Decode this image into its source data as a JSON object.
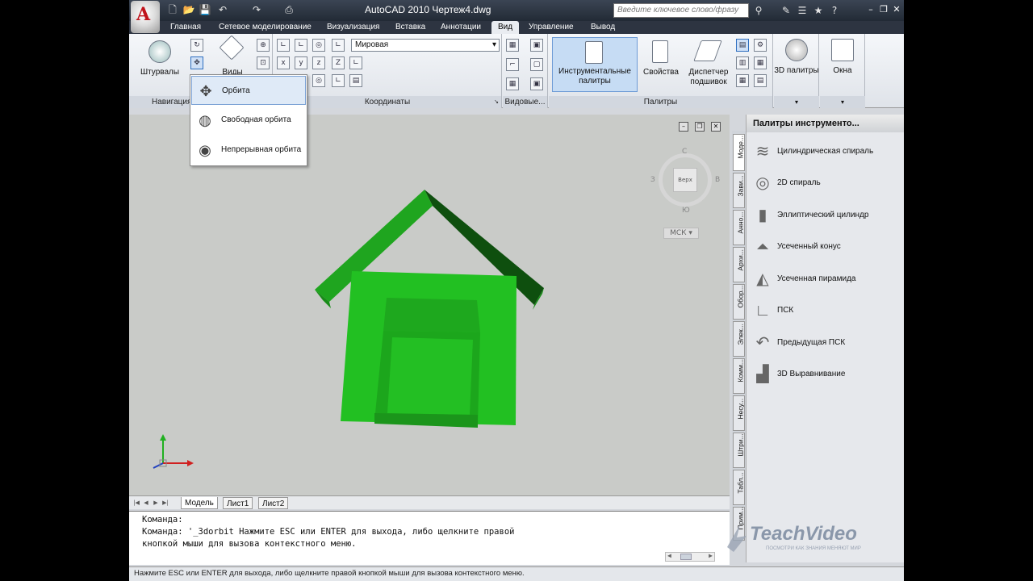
{
  "window": {
    "title": "AutoCAD 2010     Чертеж4.dwg"
  },
  "search": {
    "placeholder": "Введите ключевое слово/фразу"
  },
  "tabs": [
    {
      "label": "Главная"
    },
    {
      "label": "Сетевое моделирование"
    },
    {
      "label": "Визуализация"
    },
    {
      "label": "Вставка"
    },
    {
      "label": "Аннотации"
    },
    {
      "label": "Вид",
      "active": true
    },
    {
      "label": "Управление"
    },
    {
      "label": "Вывод"
    }
  ],
  "ribbon": {
    "navigation": {
      "title": "Навигация",
      "steering_label": "Штурвалы",
      "views_label": "Виды"
    },
    "coordinates": {
      "title": "Координаты",
      "ucs_select": "Мировая"
    },
    "viewports": {
      "title": "Видовые..."
    },
    "palettes": {
      "title": "Палитры",
      "tool_palettes": "Инструментальные палитры",
      "properties": "Свойства",
      "sheet_manager": "Диспетчер подшивок",
      "palettes3d": "3D палитры"
    },
    "windows": {
      "label": "Окна"
    }
  },
  "orbit_menu": {
    "items": [
      {
        "label": "Орбита",
        "selected": true
      },
      {
        "label": "Свободная орбита"
      },
      {
        "label": "Непрерывная орбита"
      }
    ]
  },
  "viewcube": {
    "face": "Верх",
    "north": "С",
    "south": "Ю",
    "west": "З",
    "east": "В",
    "wcs": "МСК"
  },
  "layout_tabs": [
    "Модель",
    "Лист1",
    "Лист2"
  ],
  "command": {
    "lines": [
      "Команда:",
      "Команда: '_3dorbit Нажмите ESC или ENTER для выхода, либо щелкните правой",
      "кнопкой мыши для вызова контекстного меню."
    ]
  },
  "status": {
    "text": "Нажмите ESC или ENTER для выхода, либо щелкните правой кнопкой мыши для вызова контекстного меню."
  },
  "palette": {
    "title": "Палитры инструменто...",
    "side_tabs": [
      "Моде...",
      "Зави...",
      "Анно...",
      "Архи...",
      "Обор...",
      "Элек...",
      "Комм...",
      "Несу...",
      "Штри...",
      "Табл...",
      "Прим..."
    ],
    "tools": [
      {
        "label": "Цилиндрическая спираль",
        "icon": "helix-icon"
      },
      {
        "label": "2D спираль",
        "icon": "spiral-icon"
      },
      {
        "label": "Эллиптический цилиндр",
        "icon": "elliptic-cylinder-icon"
      },
      {
        "label": "Усеченный конус",
        "icon": "cone-frustum-icon"
      },
      {
        "label": "Усеченная пирамида",
        "icon": "pyramid-frustum-icon"
      },
      {
        "label": "ПСК",
        "icon": "ucs-icon"
      },
      {
        "label": "Предыдущая ПСК",
        "icon": "ucs-previous-icon"
      },
      {
        "label": "3D Выравнивание",
        "icon": "align-3d-icon"
      }
    ]
  },
  "watermark": {
    "brand": "TeachVideo",
    "slogan": "ПОСМОТРИ КАК ЗНАНИЯ МЕНЯЮТ МИР"
  },
  "colors": {
    "model": "#22c022",
    "viewport_bg": "#c9cbc8",
    "titlebar": "#2d3441"
  }
}
